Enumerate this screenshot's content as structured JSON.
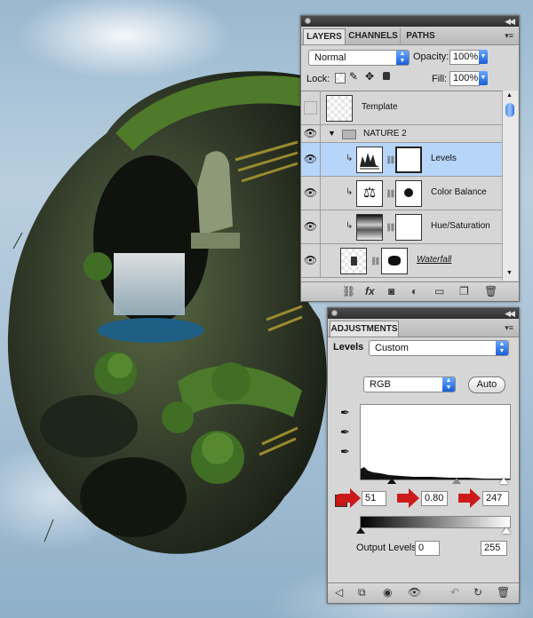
{
  "layers_panel": {
    "tabs": [
      "LAYERS",
      "CHANNELS",
      "PATHS"
    ],
    "blend_mode": "Normal",
    "opacity_label": "Opacity:",
    "opacity_value": "100%",
    "lock_label": "Lock:",
    "fill_label": "Fill:",
    "fill_value": "100%",
    "layers": [
      {
        "name": "Template"
      },
      {
        "name": "NATURE 2"
      },
      {
        "name": "Levels"
      },
      {
        "name": "Color Balance"
      },
      {
        "name": "Hue/Saturation"
      },
      {
        "name": "Waterfall"
      }
    ],
    "footer_icons": [
      "link-icon",
      "fx-icon",
      "mask-icon",
      "adjustment-icon",
      "folder-icon",
      "new-layer-icon",
      "trash-icon"
    ]
  },
  "adjustments_panel": {
    "tab": "ADJUSTMENTS",
    "adjustment_label": "Levels",
    "preset_value": "Custom",
    "channel_value": "RGB",
    "auto_label": "Auto",
    "input_black": "51",
    "input_gamma": "0.80",
    "input_white": "247",
    "output_label": "Output Levels:",
    "output_black": "0",
    "output_white": "255",
    "footer_icons": [
      "back-icon",
      "expand-icon",
      "clip-icon",
      "eye-icon",
      "reset-previous-icon",
      "reset-icon",
      "trash-icon"
    ]
  },
  "colors": {
    "selection": "#b7d5f8",
    "accent_blue": "#1a5fd6",
    "red_arrow": "#cc1a1a"
  }
}
